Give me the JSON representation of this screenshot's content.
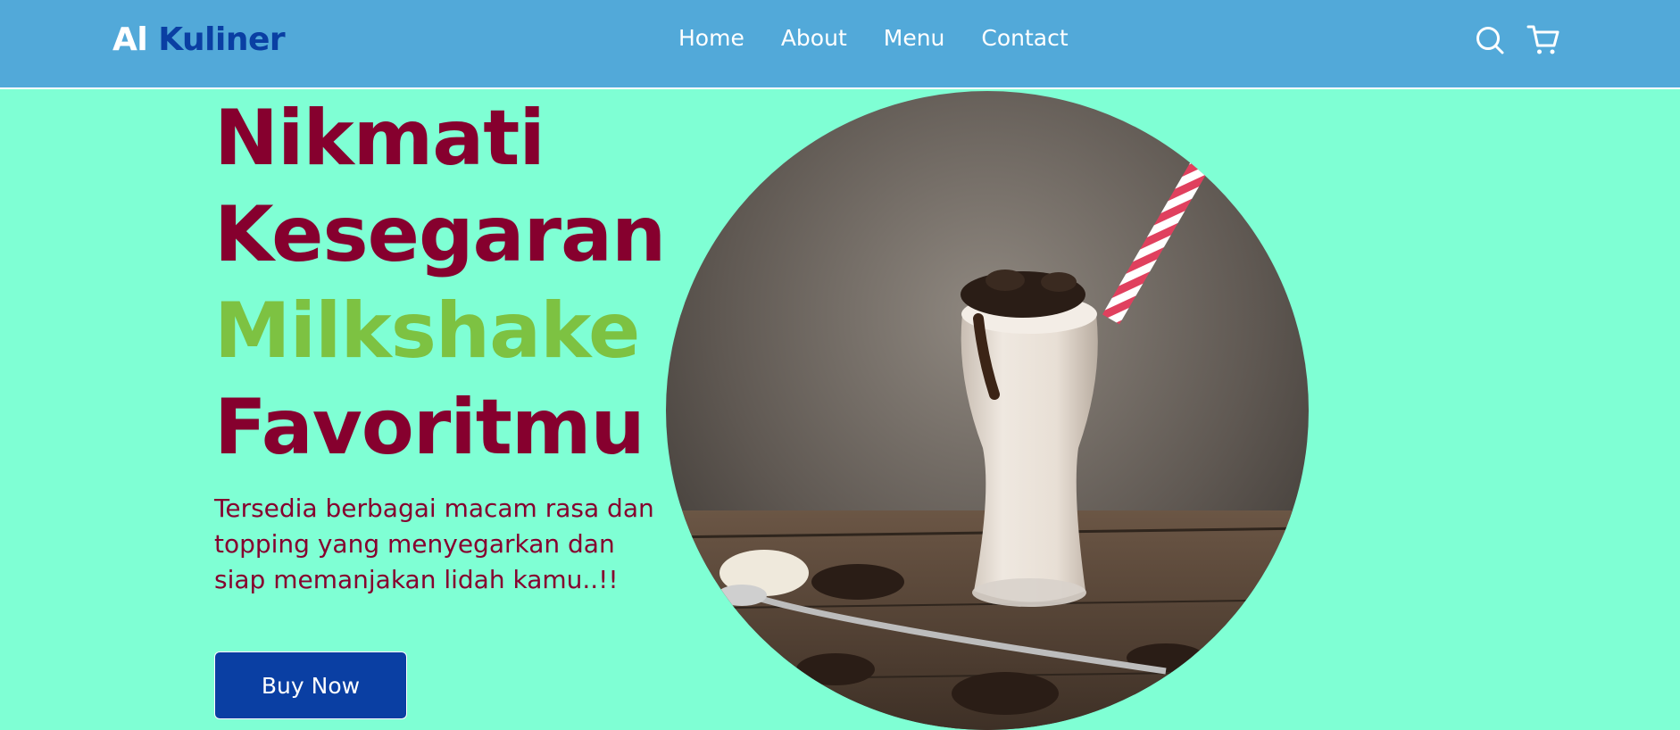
{
  "brand": {
    "part1": "Al",
    "part2": "Kuliner"
  },
  "nav": {
    "links": [
      {
        "label": "Home"
      },
      {
        "label": "About"
      },
      {
        "label": "Menu"
      },
      {
        "label": "Contact"
      }
    ],
    "icons": [
      "search-icon",
      "cart-icon"
    ]
  },
  "hero": {
    "title_lines": [
      "Nikmati",
      "Kesegaran",
      "Milkshake",
      "Favoritmu"
    ],
    "description": "Tersedia berbagai macam rasa dan topping yang menyegarkan dan siap memanjakan lidah kamu..!!",
    "button_label": "Buy Now",
    "image": "oreo-milkshake-photo"
  },
  "colors": {
    "navbar": "#52a9d9",
    "background": "#7fffd4",
    "brand_dark": "#0a3fa3",
    "title": "#86002e",
    "accent": "#7dc242",
    "button": "#0a3fa3"
  }
}
